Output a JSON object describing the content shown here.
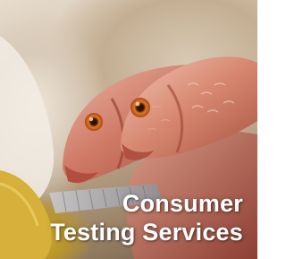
{
  "image": {
    "subject": "photo of whole red snapper fish",
    "caption_line_1": "Consumer",
    "caption_line_2": "Testing Services",
    "colors": {
      "caption_text": "#ffffff",
      "fish_red": "#c0584a",
      "background_cream": "#e6dccd",
      "yellow_accent": "#c9a732"
    }
  }
}
